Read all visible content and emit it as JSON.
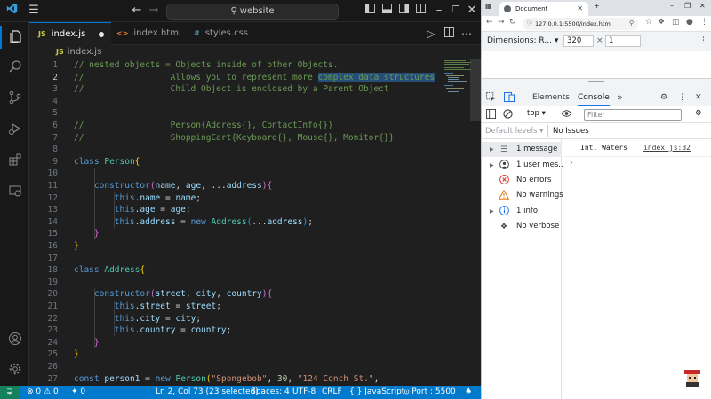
{
  "vscode": {
    "search": {
      "label": "website"
    },
    "tabs": [
      {
        "ext": "JS",
        "label": "index.js",
        "active": true,
        "dirty": true
      },
      {
        "ext": "<>",
        "label": "index.html",
        "active": false
      },
      {
        "ext": "#",
        "label": "styles.css",
        "active": false
      }
    ],
    "breadcrumb": {
      "ext": "JS",
      "label": "index.js"
    },
    "line_numbers": [
      "1",
      "2",
      "3",
      "4",
      "5",
      "6",
      "7",
      "8",
      "9",
      "10",
      "11",
      "12",
      "13",
      "14",
      "15",
      "16",
      "17",
      "18",
      "19",
      "20",
      "21",
      "22",
      "23",
      "24",
      "25",
      "26",
      "27"
    ],
    "code": {
      "l1": "// nested objects = Objects inside of other Objects.",
      "l2a": "//                 Allows you to represent more ",
      "l2b": "complex data structures",
      "l3": "//                 Child Object is enclosed by a Parent Object",
      "l6": "//                 Person{Address{}, ContactInfo{}}",
      "l7": "//                 ShoppingCart{Keyboard{}, Mouse{}, Monitor{}}",
      "kw_class": "class",
      "kw_constructor": "constructor",
      "kw_this": "this",
      "kw_new": "new",
      "kw_const": "const",
      "cls_person": "Person",
      "cls_address": "Address",
      "p_name": "name",
      "p_age": "age",
      "p_address": "address",
      "p_street": "street",
      "p_city": "city",
      "p_country": "country",
      "spread": "...",
      "v_person1": "person1",
      "s_spongebob": "\"Spongebob\"",
      "n_30": "30",
      "s_conch": "\"124 Conch St.\"",
      "open_brace": "{",
      "close_brace": "}",
      "open_paren": "(",
      "close_paren": ")",
      "comma": ", ",
      "dot": ".",
      "eq": " = ",
      "semi": ";"
    },
    "status": {
      "errors": "0",
      "warnings": "0",
      "ports": "0",
      "position": "Ln 2, Col 73 (23 selected)",
      "spaces": "Spaces: 4",
      "encoding": "UTF-8",
      "eol": "CRLF",
      "language": "JavaScript",
      "port": "Port : 5500"
    }
  },
  "browser": {
    "tab_title": "Document",
    "url": "127.0.0.1:5500/index.html",
    "dimensions_label": "Dimensions: R...",
    "width_value": "320",
    "height_value": "1",
    "devtools_tabs": [
      "Elements",
      "Console"
    ],
    "context": "top",
    "filter_placeholder": "Filter",
    "default_levels": "Default levels",
    "no_issues": "No Issues",
    "sidebar": [
      {
        "label": "1 message",
        "icon": "list-icon",
        "arrow": true
      },
      {
        "label": "1 user mes...",
        "icon": "user-icon",
        "arrow": true
      },
      {
        "label": "No errors",
        "icon": "error-icon",
        "arrow": false
      },
      {
        "label": "No warnings",
        "icon": "warning-icon",
        "arrow": false
      },
      {
        "label": "1 info",
        "icon": "info-icon",
        "arrow": true
      },
      {
        "label": "No verbose",
        "icon": "bug-icon",
        "arrow": false
      }
    ],
    "log": {
      "message": "Int. Waters",
      "source": "index.js:32"
    }
  },
  "colors": {
    "accent": "#007acc",
    "remote": "#16825d",
    "console_accent": "#1a73e8"
  }
}
